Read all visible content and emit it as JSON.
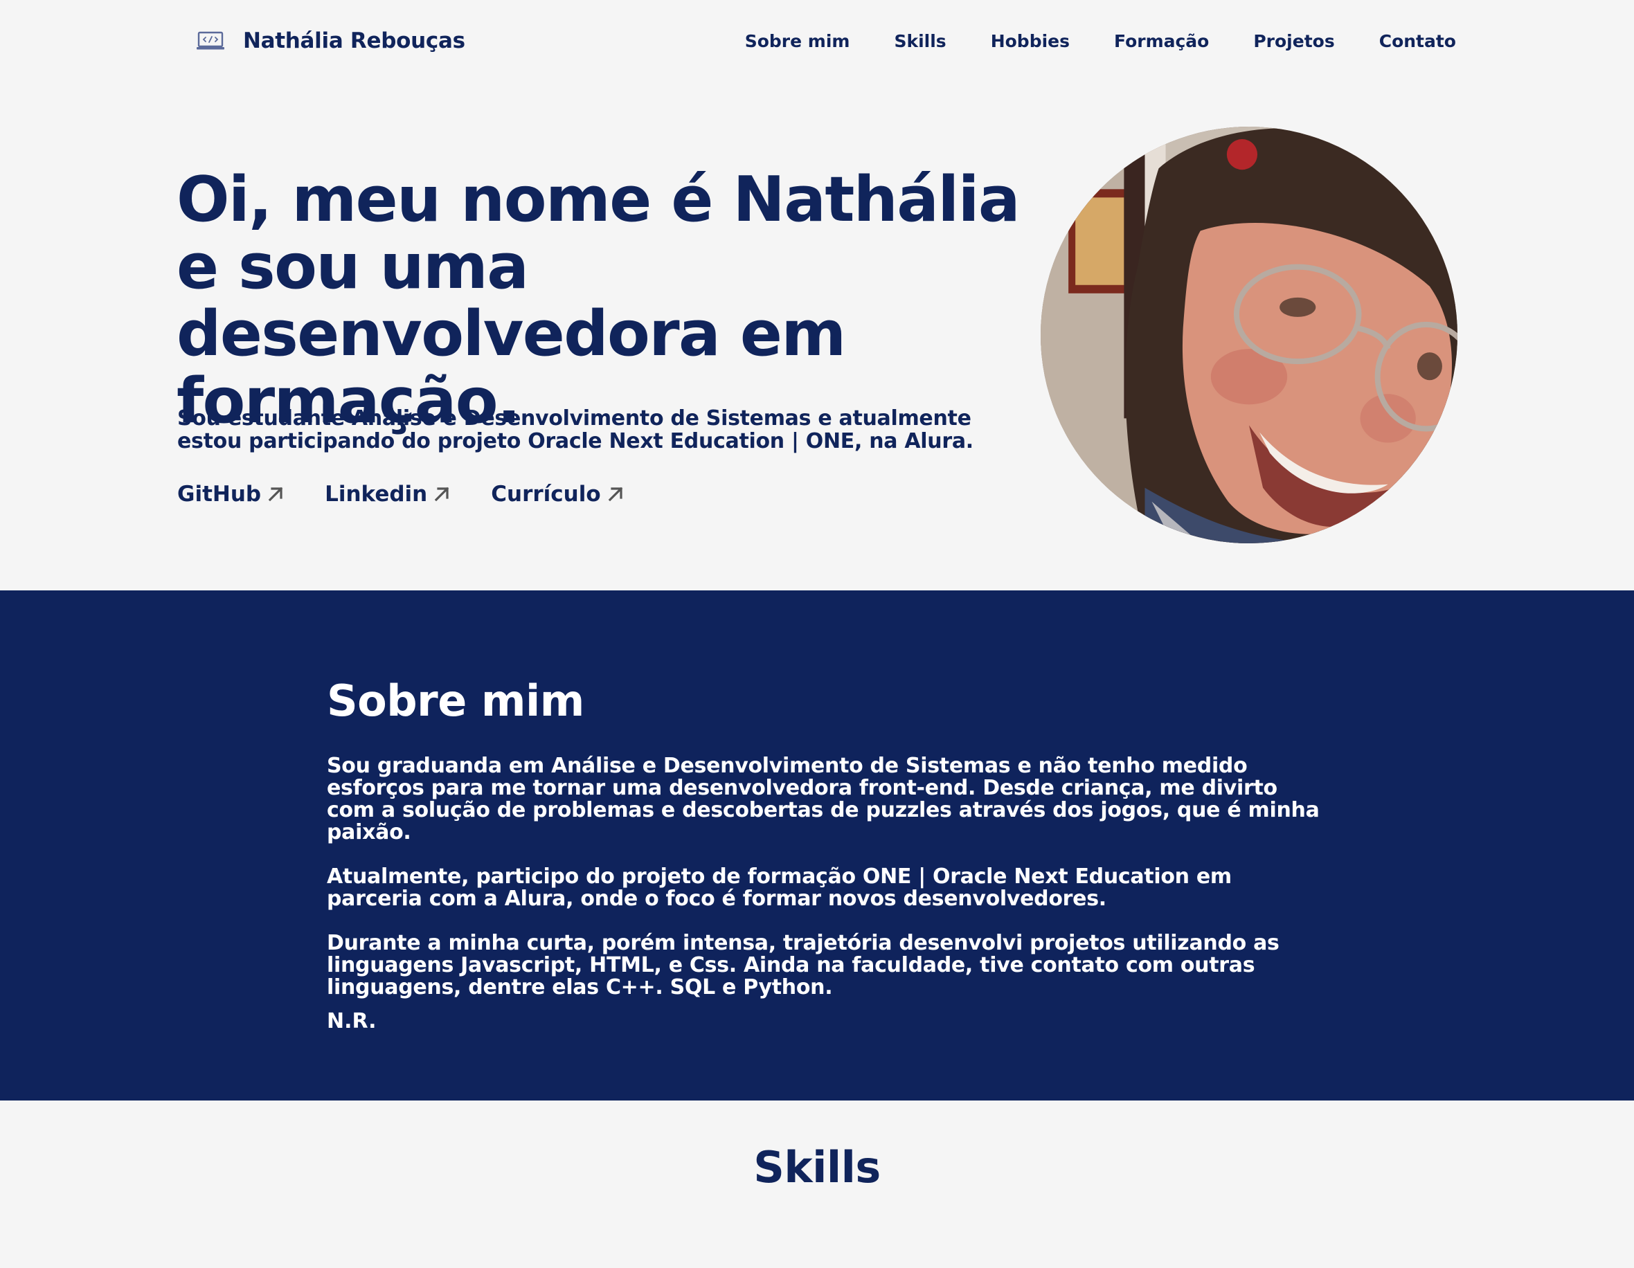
{
  "header": {
    "brand_name": "Nathália Rebouças",
    "brand_icon": "laptop-code-icon",
    "nav": [
      {
        "label": "Sobre mim"
      },
      {
        "label": "Skills"
      },
      {
        "label": "Hobbies"
      },
      {
        "label": "Formação"
      },
      {
        "label": "Projetos"
      },
      {
        "label": "Contato"
      }
    ]
  },
  "hero": {
    "title": "Oi, meu nome é Nathália e sou uma desenvolvedora em formação.",
    "description": "Sou estudante Análise e Desenvolvimento de Sistemas e atualmente estou participando do projeto Oracle Next Education | ONE, na Alura.",
    "links": [
      {
        "label": "GitHub",
        "icon": "arrow-up-right-icon"
      },
      {
        "label": "Linkedin",
        "icon": "arrow-up-right-icon"
      },
      {
        "label": "Currículo",
        "icon": "arrow-up-right-icon"
      }
    ]
  },
  "about": {
    "title": "Sobre mim",
    "paragraphs": [
      "Sou graduanda em Análise e Desenvolvimento de Sistemas e não tenho medido esforços para me tornar uma desenvolvedora front-end. Desde criança, me divirto com a solução de problemas e descobertas de puzzles através dos jogos, que é minha paixão.",
      "Atualmente, participo do projeto de formação ONE | Oracle Next Education em parceria com a Alura, onde o foco é formar novos desenvolvedores.",
      "Durante a minha curta, porém intensa, trajetória desenvolvi projetos utilizando as linguagens Javascript, HTML, e Css. Ainda na faculdade, tive contato com outras linguagens, dentre elas C++. SQL e Python."
    ],
    "signature": "N.R."
  },
  "skills": {
    "title": "Skills"
  },
  "colors": {
    "navy": "#0f235c",
    "text": "#10245b",
    "background": "#f5f5f5",
    "white": "#ffffff"
  }
}
